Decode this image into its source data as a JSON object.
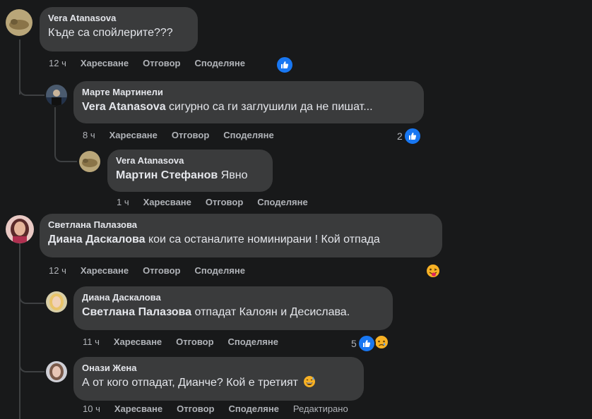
{
  "comments": [
    {
      "author": "Vera Atanasova",
      "mention": "",
      "text": "Къде са спойлерите???",
      "time": "12 ч",
      "like_label": "Харесване",
      "reply_label": "Отговор",
      "share_label": "Споделяне",
      "reaction_count": ""
    },
    {
      "author": "Марте Мартинели",
      "mention": "Vera Atanasova",
      "text": " сигурно са ги заглушили да не пишат...",
      "time": "8 ч",
      "like_label": "Харесване",
      "reply_label": "Отговор",
      "share_label": "Споделяне",
      "reaction_count": "2"
    },
    {
      "author": "Vera Atanasova",
      "mention": "Мартин Стефанов",
      "text": " Явно",
      "time": "1 ч",
      "like_label": "Харесване",
      "reply_label": "Отговор",
      "share_label": "Споделяне",
      "reaction_count": ""
    },
    {
      "author": "Светлана Палазова",
      "mention": "Диана Даскалова",
      "text": " кои са останалите номинирани ! Кой отпада",
      "time": "12 ч",
      "like_label": "Харесване",
      "reply_label": "Отговор",
      "share_label": "Споделяне",
      "reaction_count": ""
    },
    {
      "author": "Диана Даскалова",
      "mention": "Светлана Палазова",
      "text": " отпадат Калоян и Десислава.",
      "time": "11 ч",
      "like_label": "Харесване",
      "reply_label": "Отговор",
      "share_label": "Споделяне",
      "reaction_count": "5"
    },
    {
      "author": "Онази Жена",
      "mention": "",
      "text": "А от кого отпадат, Дианче? Кой е третият",
      "time": "10 ч",
      "like_label": "Харесване",
      "reply_label": "Отговор",
      "share_label": "Споделяне",
      "edited_label": "Редактирано",
      "reaction_count": ""
    }
  ],
  "icons": {
    "like": "thumbs-up-icon",
    "tongue": "tongue-emoji-icon",
    "sad": "sad-emoji-icon",
    "sweat": "grinning-sweat-emoji-icon"
  },
  "colors": {
    "background": "#18191a",
    "bubble": "#3a3b3c",
    "like_blue": "#1877f2",
    "secondary_text": "#b0b3b8"
  }
}
